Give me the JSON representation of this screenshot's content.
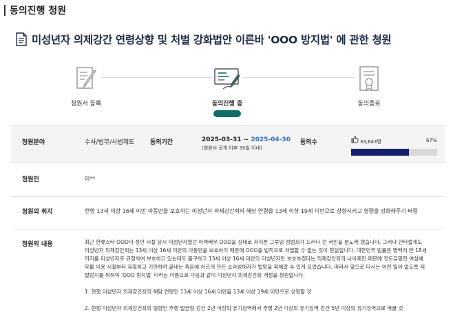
{
  "header": {
    "title": "동의진행 청원"
  },
  "petition": {
    "title": "미성년자 의제강간 연령상향 및 처벌 강화법안 이른바 'OOO 방지법' 에 관한 청원"
  },
  "steps": [
    {
      "label": "청원서 등록",
      "icon": "pen-document-icon",
      "active": false
    },
    {
      "label": "동의진행 중",
      "icon": "signing-document-icon",
      "active": true
    },
    {
      "label": "동의종료",
      "icon": "certificate-icon",
      "active": false
    }
  ],
  "info": {
    "field_label": "청원분야",
    "field_value": "수사/법무/사법제도",
    "period_label": "동의기간",
    "period_start": "2025-03-31",
    "period_sep": " ~ ",
    "period_end": "2025-04-30",
    "period_note": "(청원서 공개 이후 30일 이내)",
    "count_label": "동의수",
    "count_value": "33,643명",
    "count_percent": "67%",
    "progress_fraction": 0.67,
    "petitioner_label": "청원인",
    "petitioner_value": "이**",
    "purpose_label": "청원의 취지",
    "purpose_value": "현행 13세 이상 16세 미만 아동만을 보호하는 미성년자 의제강간죄의 해당 연령을 13세 이상 19세 미만으로 상향시키고 형량을 강화해주기 바람",
    "content_label": "청원의 내용",
    "content_lines": [
      "최근 한류스타 OOO이 성인 시절 당시 미성년자였던 아역배우 OOO을 상대로 저지른 그루밍 성범죄가 드러나 전 국민을 분노케 했습니다. 그러나 안타깝게도",
      "미성년자 의제강간죄는 13세 이상 16세 미만의 아동만을 보호하기 때문에 OOO을 법적으로 처벌할 수 없는 것이 현실입니다. 대한민국 법률은 명백히 만 18세",
      "까지를 미성년자로 규정하여 보호하고 있는데도 불구하고 13세 이상 16세 미만의 미성년자만 보호하겠다는 의제강간죄의 나이제한 때문에 전도유망한 여성배",
      "우를 이용 시절부터 유혹하고 기만하여 끝내는 죽음에 이르게 만든 소아성애자가 법망을 피해갈 수 있게 되었습니다. 따라서 앞으로 다시는 이런 일이 없도록 재",
      "발방지를 위하여 'OOO 방지법' 이라는 이름으로 다음과 같이 미성년자 의제강간죄 개정을 청원합니다."
    ],
    "content_items": [
      "1. 현행 미성년자 의제강간죄의 해당 연령인 13세 이상 16세 미만을 13세 이상 19세 미만으로 상향할 것",
      "2. 현행 미성년자 의제강간죄의 형량인 주행 벌금형 강간 2년 이상의 유기징역에서 주행 2년 이상의 유기징역 강간 5년 이상의 유기징역으로 바꿀 것"
    ]
  },
  "colors": {
    "accent": "#0f6e6a",
    "progress": "#13206b",
    "date_end": "#2d6ec9"
  }
}
